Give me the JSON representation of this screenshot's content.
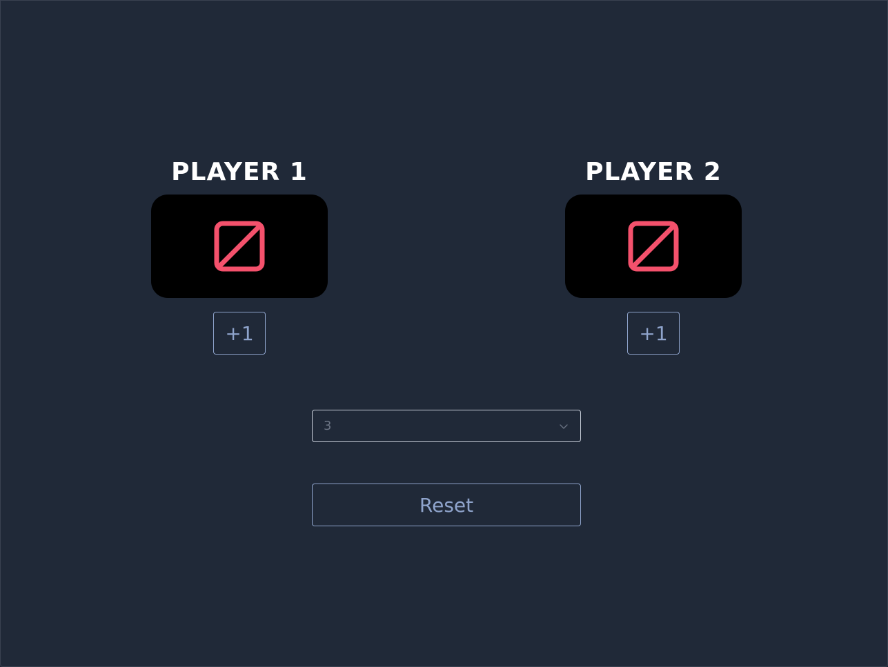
{
  "players": [
    {
      "title": "PLAYER 1",
      "score_icon": "null-empty-icon",
      "increment_label": "+1"
    },
    {
      "title": "PLAYER 2",
      "score_icon": "null-empty-icon",
      "increment_label": "+1"
    }
  ],
  "rounds_select": {
    "selected_value": "3",
    "icon": "chevron-down-icon"
  },
  "reset_label": "Reset",
  "colors": {
    "background": "#202938",
    "score_box": "#000000",
    "icon_accent": "#f4516c",
    "button_text": "#8fa4cc",
    "title_text": "#ffffff",
    "select_text": "#6c7585"
  }
}
